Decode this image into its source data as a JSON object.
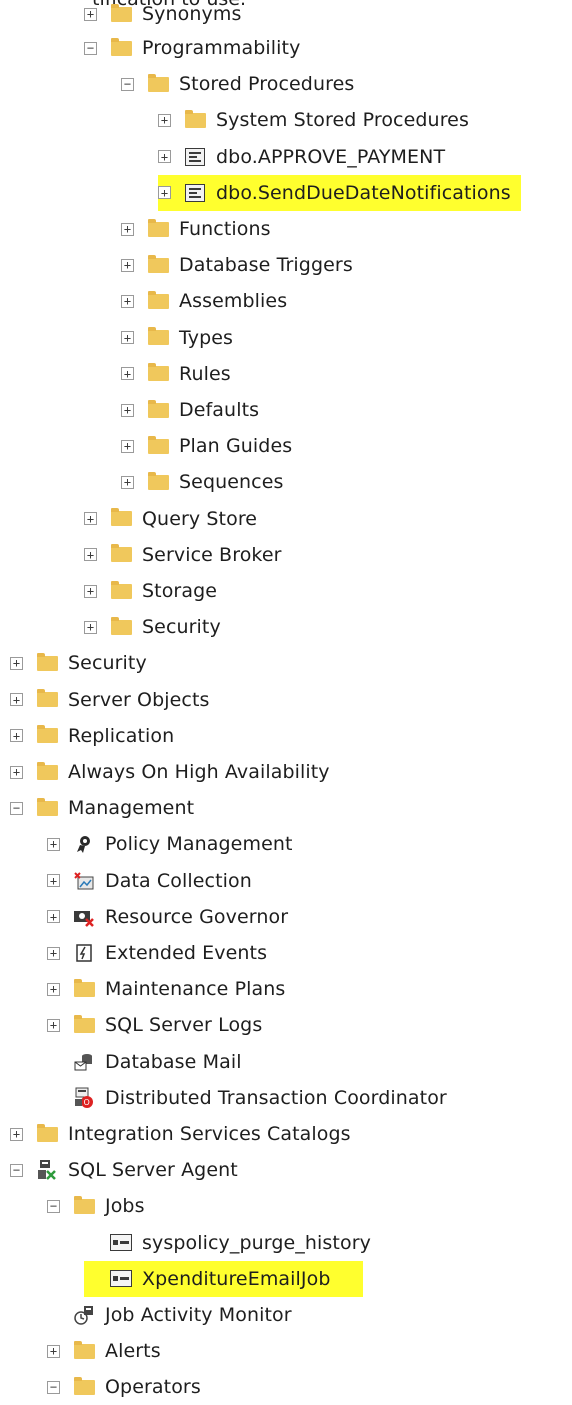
{
  "header_cutoff": "tification to use.",
  "tree": [
    {
      "label": "Synonyms",
      "indent": 3,
      "toggle": "+",
      "icon": "folder",
      "partial": true
    },
    {
      "label": "Programmability",
      "indent": 3,
      "toggle": "−",
      "icon": "folder"
    },
    {
      "label": "Stored Procedures",
      "indent": 4,
      "toggle": "−",
      "icon": "folder"
    },
    {
      "label": "System Stored Procedures",
      "indent": 5,
      "toggle": "+",
      "icon": "folder"
    },
    {
      "label": "dbo.APPROVE_PAYMENT",
      "indent": 5,
      "toggle": "+",
      "icon": "stored-procedure"
    },
    {
      "label": "dbo.SendDueDateNotifications",
      "indent": 5,
      "toggle": "+",
      "icon": "stored-procedure",
      "highlight": true
    },
    {
      "label": "Functions",
      "indent": 4,
      "toggle": "+",
      "icon": "folder"
    },
    {
      "label": "Database Triggers",
      "indent": 4,
      "toggle": "+",
      "icon": "folder"
    },
    {
      "label": "Assemblies",
      "indent": 4,
      "toggle": "+",
      "icon": "folder"
    },
    {
      "label": "Types",
      "indent": 4,
      "toggle": "+",
      "icon": "folder"
    },
    {
      "label": "Rules",
      "indent": 4,
      "toggle": "+",
      "icon": "folder"
    },
    {
      "label": "Defaults",
      "indent": 4,
      "toggle": "+",
      "icon": "folder"
    },
    {
      "label": "Plan Guides",
      "indent": 4,
      "toggle": "+",
      "icon": "folder"
    },
    {
      "label": "Sequences",
      "indent": 4,
      "toggle": "+",
      "icon": "folder"
    },
    {
      "label": "Query Store",
      "indent": 3,
      "toggle": "+",
      "icon": "folder"
    },
    {
      "label": "Service Broker",
      "indent": 3,
      "toggle": "+",
      "icon": "folder"
    },
    {
      "label": "Storage",
      "indent": 3,
      "toggle": "+",
      "icon": "folder"
    },
    {
      "label": "Security",
      "indent": 3,
      "toggle": "+",
      "icon": "folder"
    },
    {
      "label": "Security",
      "indent": 1,
      "toggle": "+",
      "icon": "folder"
    },
    {
      "label": "Server Objects",
      "indent": 1,
      "toggle": "+",
      "icon": "folder"
    },
    {
      "label": "Replication",
      "indent": 1,
      "toggle": "+",
      "icon": "folder"
    },
    {
      "label": "Always On High Availability",
      "indent": 1,
      "toggle": "+",
      "icon": "folder"
    },
    {
      "label": "Management",
      "indent": 1,
      "toggle": "−",
      "icon": "folder"
    },
    {
      "label": "Policy Management",
      "indent": 2,
      "toggle": "+",
      "icon": "policy"
    },
    {
      "label": "Data Collection",
      "indent": 2,
      "toggle": "+",
      "icon": "data-collection"
    },
    {
      "label": "Resource Governor",
      "indent": 2,
      "toggle": "+",
      "icon": "resource-governor"
    },
    {
      "label": "Extended Events",
      "indent": 2,
      "toggle": "+",
      "icon": "extended-events"
    },
    {
      "label": "Maintenance Plans",
      "indent": 2,
      "toggle": "+",
      "icon": "folder"
    },
    {
      "label": "SQL Server Logs",
      "indent": 2,
      "toggle": "+",
      "icon": "folder"
    },
    {
      "label": "Database Mail",
      "indent": 2,
      "toggle": "",
      "icon": "database-mail"
    },
    {
      "label": "Distributed Transaction Coordinator",
      "indent": 2,
      "toggle": "",
      "icon": "dtc"
    },
    {
      "label": "Integration Services Catalogs",
      "indent": 1,
      "toggle": "+",
      "icon": "folder"
    },
    {
      "label": "SQL Server Agent",
      "indent": 1,
      "toggle": "−",
      "icon": "sql-agent"
    },
    {
      "label": "Jobs",
      "indent": 2,
      "toggle": "−",
      "icon": "folder"
    },
    {
      "label": "syspolicy_purge_history",
      "indent": 3,
      "toggle": "",
      "icon": "job"
    },
    {
      "label": "XpenditureEmailJob",
      "indent": 3,
      "toggle": "",
      "icon": "job",
      "highlight": true
    },
    {
      "label": "Job Activity Monitor",
      "indent": 2,
      "toggle": "",
      "icon": "job-activity-monitor"
    },
    {
      "label": "Alerts",
      "indent": 2,
      "toggle": "+",
      "icon": "folder"
    },
    {
      "label": "Operators",
      "indent": 2,
      "toggle": "−",
      "icon": "folder",
      "partial": true
    }
  ]
}
